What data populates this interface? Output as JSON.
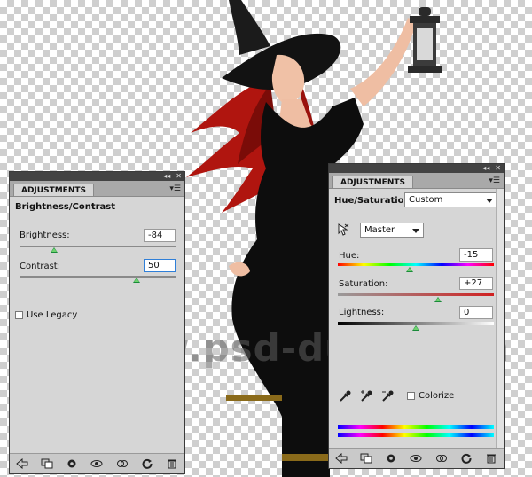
{
  "watermark": "www.psd-dude.com",
  "left_panel": {
    "tab_label": "ADJUSTMENTS",
    "title": "Brightness/Contrast",
    "brightness": {
      "label": "Brightness:",
      "value": "-84",
      "level": 0.22
    },
    "contrast": {
      "label": "Contrast:",
      "value": "50",
      "level": 0.75
    },
    "use_legacy": {
      "label": "Use Legacy",
      "checked": false
    }
  },
  "right_panel": {
    "tab_label": "ADJUSTMENTS",
    "title": "Hue/Saturation",
    "preset": "Custom",
    "channel": "Master",
    "hue": {
      "label": "Hue:",
      "value": "-15",
      "level": 0.46
    },
    "saturation": {
      "label": "Saturation:",
      "value": "+27",
      "level": 0.64
    },
    "lightness": {
      "label": "Lightness:",
      "value": "0",
      "level": 0.5
    },
    "colorize": {
      "label": "Colorize",
      "checked": false
    }
  },
  "colors": {
    "panel_bg": "#d6d6d6",
    "panel_header": "#434343",
    "tab_bar": "#a9a9a9",
    "slider_thumb": "#1a8a3a",
    "focus_border": "#2f7fd8"
  },
  "footer_icons": [
    "back-arrow-icon",
    "clip-layer-icon",
    "visibility-eye-icon",
    "view-previous-icon",
    "reset-icon",
    "trash-icon"
  ]
}
